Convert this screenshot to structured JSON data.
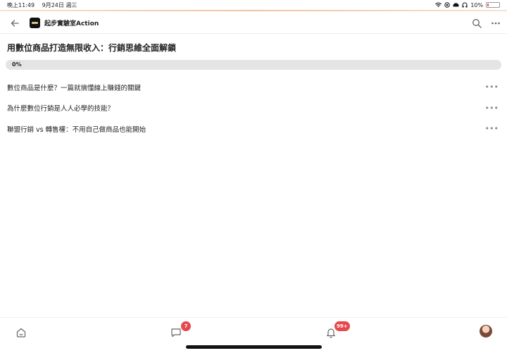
{
  "status_bar": {
    "time": "晚上11:49",
    "date": "9月24日 週三",
    "battery": "10%",
    "battery_level": 0.1
  },
  "header": {
    "title": "起步實驗室Action",
    "icons": {
      "back": "arrow-left-icon",
      "search": "search-icon",
      "more": "more-horizontal-icon"
    }
  },
  "course": {
    "title": "用數位商品打造無限收入：行銷思維全面解鎖",
    "progress_label": "0%",
    "progress": 0
  },
  "lessons": [
    {
      "title": "數位商品是什麼？一篇就搞懂線上賺錢的關鍵",
      "more": "•••"
    },
    {
      "title": "為什麼數位行銷是人人必學的技能？",
      "more": "•••"
    },
    {
      "title": "聯盟行銷 vs 轉售權：不用自己做商品也能開始",
      "more": "•••"
    }
  ],
  "tabbar": {
    "chat_badge": "7",
    "notification_badge": "99+",
    "icons": {
      "home": "home-icon",
      "chat": "chat-icon",
      "bell": "bell-icon",
      "avatar": "avatar"
    }
  },
  "colors": {
    "badge": "#e5484d",
    "progress_track": "#e4e4e4"
  }
}
